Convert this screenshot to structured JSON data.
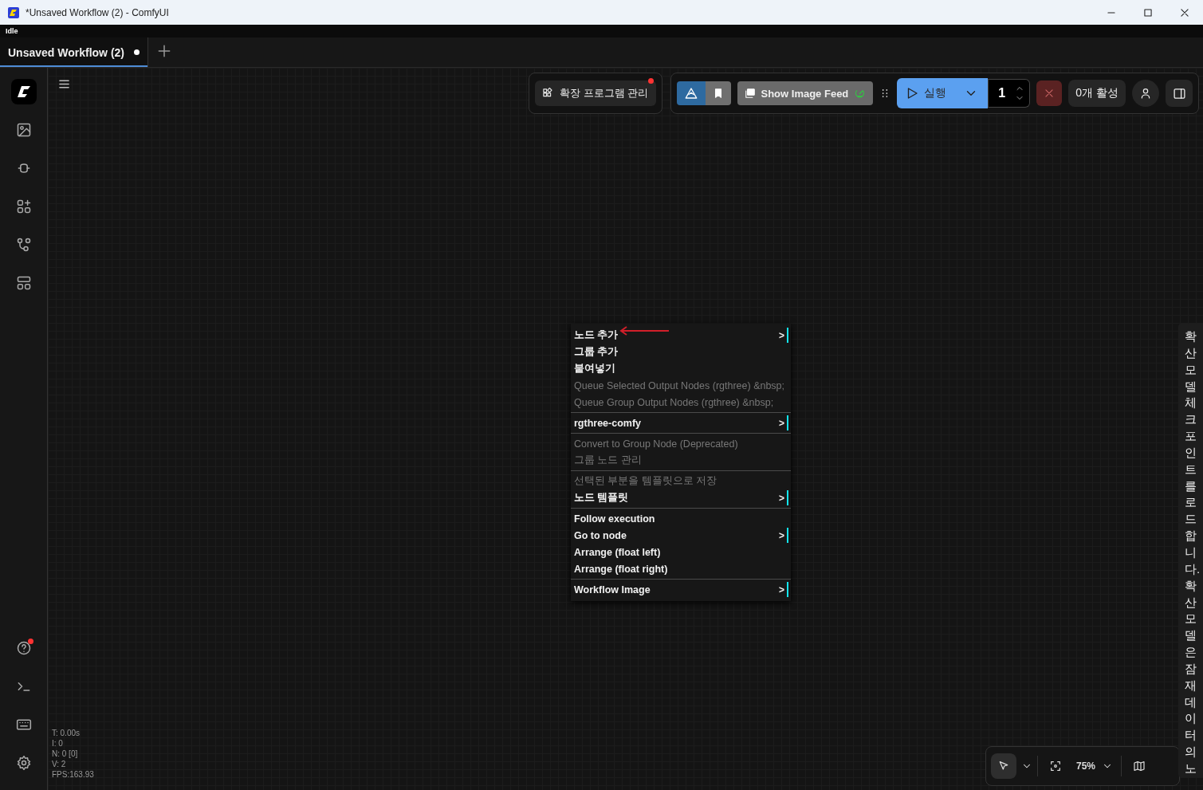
{
  "window": {
    "title": "*Unsaved Workflow (2) - ComfyUI"
  },
  "status": "Idle",
  "tabs": [
    {
      "label": "Unsaved Workflow (2)",
      "selected": true,
      "modified": true
    }
  ],
  "sidebar": {
    "help_badge": true
  },
  "top_actions": {
    "extensions_label": "확장 프로그램 관리",
    "extensions_badge": true,
    "image_feed_label": "Show Image Feed",
    "run_label": "실행",
    "batch_count": "1",
    "active_jobs": "0개 활성"
  },
  "context_menu": {
    "groups": [
      [
        {
          "label": "노드 추가",
          "disabled": false,
          "arrow": ">"
        },
        {
          "label": "그룹 추가",
          "disabled": false
        },
        {
          "label": "붙여넣기",
          "disabled": false
        },
        {
          "label": "Queue Selected Output Nodes (rgthree) &nbsp;",
          "disabled": true
        },
        {
          "label": "Queue Group Output Nodes (rgthree) &nbsp;",
          "disabled": true
        }
      ],
      [
        {
          "label": "rgthree-comfy",
          "disabled": false,
          "arrow": ">"
        }
      ],
      [
        {
          "label": "Convert to Group Node (Deprecated)",
          "disabled": true
        },
        {
          "label": "그룹 노드 관리",
          "disabled": true
        }
      ],
      [
        {
          "label": "선택된 부분을 템플릿으로 저장",
          "disabled": true
        },
        {
          "label": "노드 템플릿",
          "disabled": false,
          "arrow": ">"
        }
      ],
      [
        {
          "label": "Follow execution",
          "disabled": false
        },
        {
          "label": "Go to node",
          "disabled": false,
          "arrow": ">"
        },
        {
          "label": "Arrange (float left)",
          "disabled": false
        },
        {
          "label": "Arrange (float right)",
          "disabled": false
        }
      ],
      [
        {
          "label": "Workflow Image",
          "disabled": false,
          "arrow": ">"
        }
      ]
    ]
  },
  "stats": [
    "T: 0.00s",
    "I: 0",
    "N: 0 [0]",
    "V: 2",
    "FPS:163.93"
  ],
  "canvas_tools": {
    "pointer_selected": true,
    "zoom": "75%"
  },
  "tooltip": "확산모델체크포인트를로드합니다.확산모델은잠재데이터의노"
}
